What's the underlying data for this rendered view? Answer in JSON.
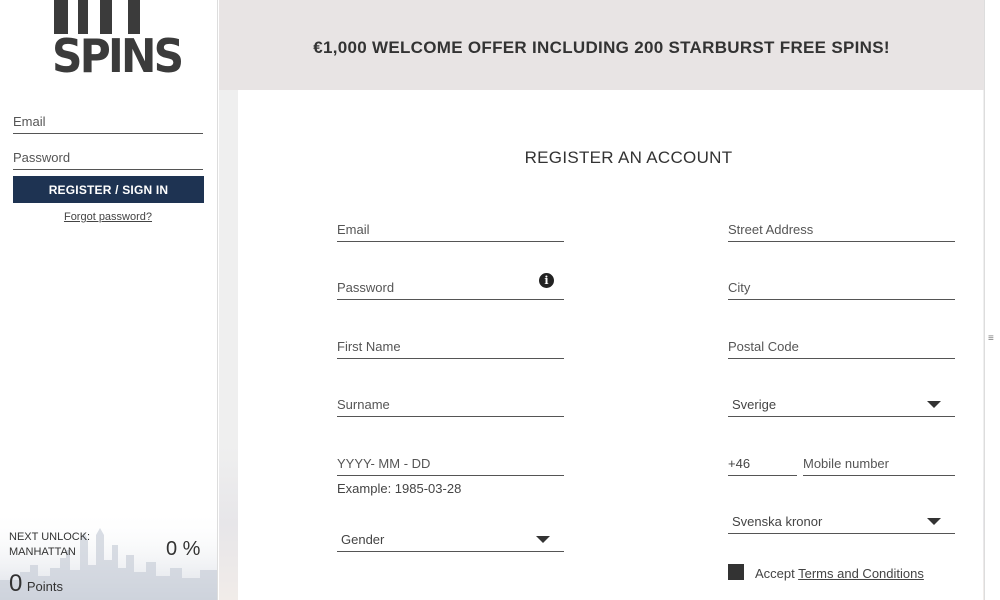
{
  "sidebar": {
    "logo_text": "SPINS",
    "email_placeholder": "Email",
    "password_placeholder": "Password",
    "signin_label": "REGISTER / SIGN IN",
    "forgot_label": "Forgot password?",
    "unlock_line1": "NEXT UNLOCK:",
    "unlock_line2": "MANHATTAN",
    "unlock_percent": "0 %",
    "points_value": "0",
    "points_label": "Points"
  },
  "banner": {
    "text": "€1,000 WELCOME OFFER INCLUDING 200 STARBURST FREE SPINS!"
  },
  "form": {
    "title": "REGISTER AN ACCOUNT",
    "left": {
      "email_placeholder": "Email",
      "password_placeholder": "Password",
      "first_name_placeholder": "First Name",
      "surname_placeholder": "Surname",
      "dob_placeholder": "YYYY- MM - DD",
      "dob_hint": "Example: 1985-03-28",
      "gender_value": "Gender"
    },
    "right": {
      "street_placeholder": "Street Address",
      "city_placeholder": "City",
      "postal_placeholder": "Postal Code",
      "country_value": "Sverige",
      "phone_prefix_value": "+46",
      "mobile_placeholder": "Mobile number",
      "currency_value": "Svenska kronor"
    },
    "accept_prefix": "Accept ",
    "terms_label": "Terms and Conditions"
  },
  "icons": {
    "info": "info-icon",
    "caret": "caret-down-icon"
  },
  "colors": {
    "button": "#1e3352",
    "banner_bg": "#e8e4e4"
  }
}
